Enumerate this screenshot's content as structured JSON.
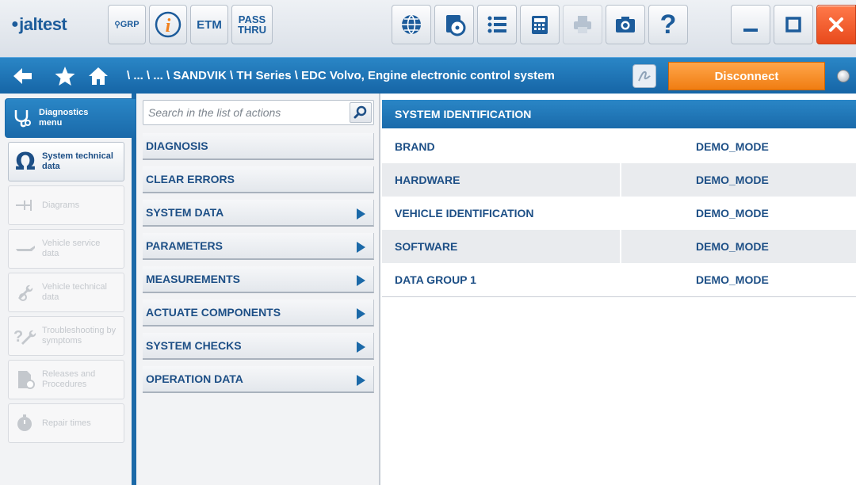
{
  "app": {
    "logo_text": "jaltest"
  },
  "toolbar": {
    "grp_label": "GRP",
    "info_label": "i",
    "etm_label": "ETM",
    "passthru_line1": "PASS",
    "passthru_line2": "THRU",
    "help_label": "?"
  },
  "navbar": {
    "breadcrumb": "\\ ... \\ ... \\ SANDVIK \\ TH Series \\ EDC Volvo, Engine electronic control system",
    "disconnect_label": "Disconnect"
  },
  "sidebar": {
    "items": [
      {
        "label": "Diagnostics menu",
        "state": "active"
      },
      {
        "label": "System technical data",
        "state": "enabled"
      },
      {
        "label": "Diagrams",
        "state": "disabled"
      },
      {
        "label": "Vehicle service data",
        "state": "disabled"
      },
      {
        "label": "Vehicle technical data",
        "state": "disabled"
      },
      {
        "label": "Troubleshooting by symptoms",
        "state": "disabled"
      },
      {
        "label": "Releases and Procedures",
        "state": "disabled"
      },
      {
        "label": "Repair times",
        "state": "disabled"
      }
    ]
  },
  "actions": {
    "search_placeholder": "Search in the list of actions",
    "items": [
      {
        "label": "DIAGNOSIS",
        "submenu": false
      },
      {
        "label": "CLEAR ERRORS",
        "submenu": false
      },
      {
        "label": "SYSTEM DATA",
        "submenu": true
      },
      {
        "label": "PARAMETERS",
        "submenu": true
      },
      {
        "label": "MEASUREMENTS",
        "submenu": true
      },
      {
        "label": "ACTUATE COMPONENTS",
        "submenu": true
      },
      {
        "label": "SYSTEM CHECKS",
        "submenu": true
      },
      {
        "label": "OPERATION DATA",
        "submenu": true
      }
    ]
  },
  "panel": {
    "title": "SYSTEM IDENTIFICATION",
    "rows": [
      {
        "key": "BRAND",
        "value": "DEMO_MODE"
      },
      {
        "key": "HARDWARE",
        "value": "DEMO_MODE"
      },
      {
        "key": "VEHICLE IDENTIFICATION",
        "value": "DEMO_MODE"
      },
      {
        "key": "SOFTWARE",
        "value": "DEMO_MODE"
      },
      {
        "key": "DATA GROUP 1",
        "value": "DEMO_MODE"
      }
    ]
  },
  "colors": {
    "brand_blue": "#1b69a8",
    "disconnect_orange": "#f07d12",
    "close_red": "#e84a1c"
  },
  "icons": {
    "toolbar": [
      "globe-icon",
      "cd-icon",
      "list-icon",
      "calculator-icon",
      "printer-icon",
      "camera-icon",
      "help-icon",
      "minimize-icon",
      "maximize-icon",
      "close-icon"
    ],
    "nav": [
      "back-arrow-icon",
      "star-icon",
      "home-icon",
      "signature-icon",
      "status-led-icon"
    ]
  }
}
